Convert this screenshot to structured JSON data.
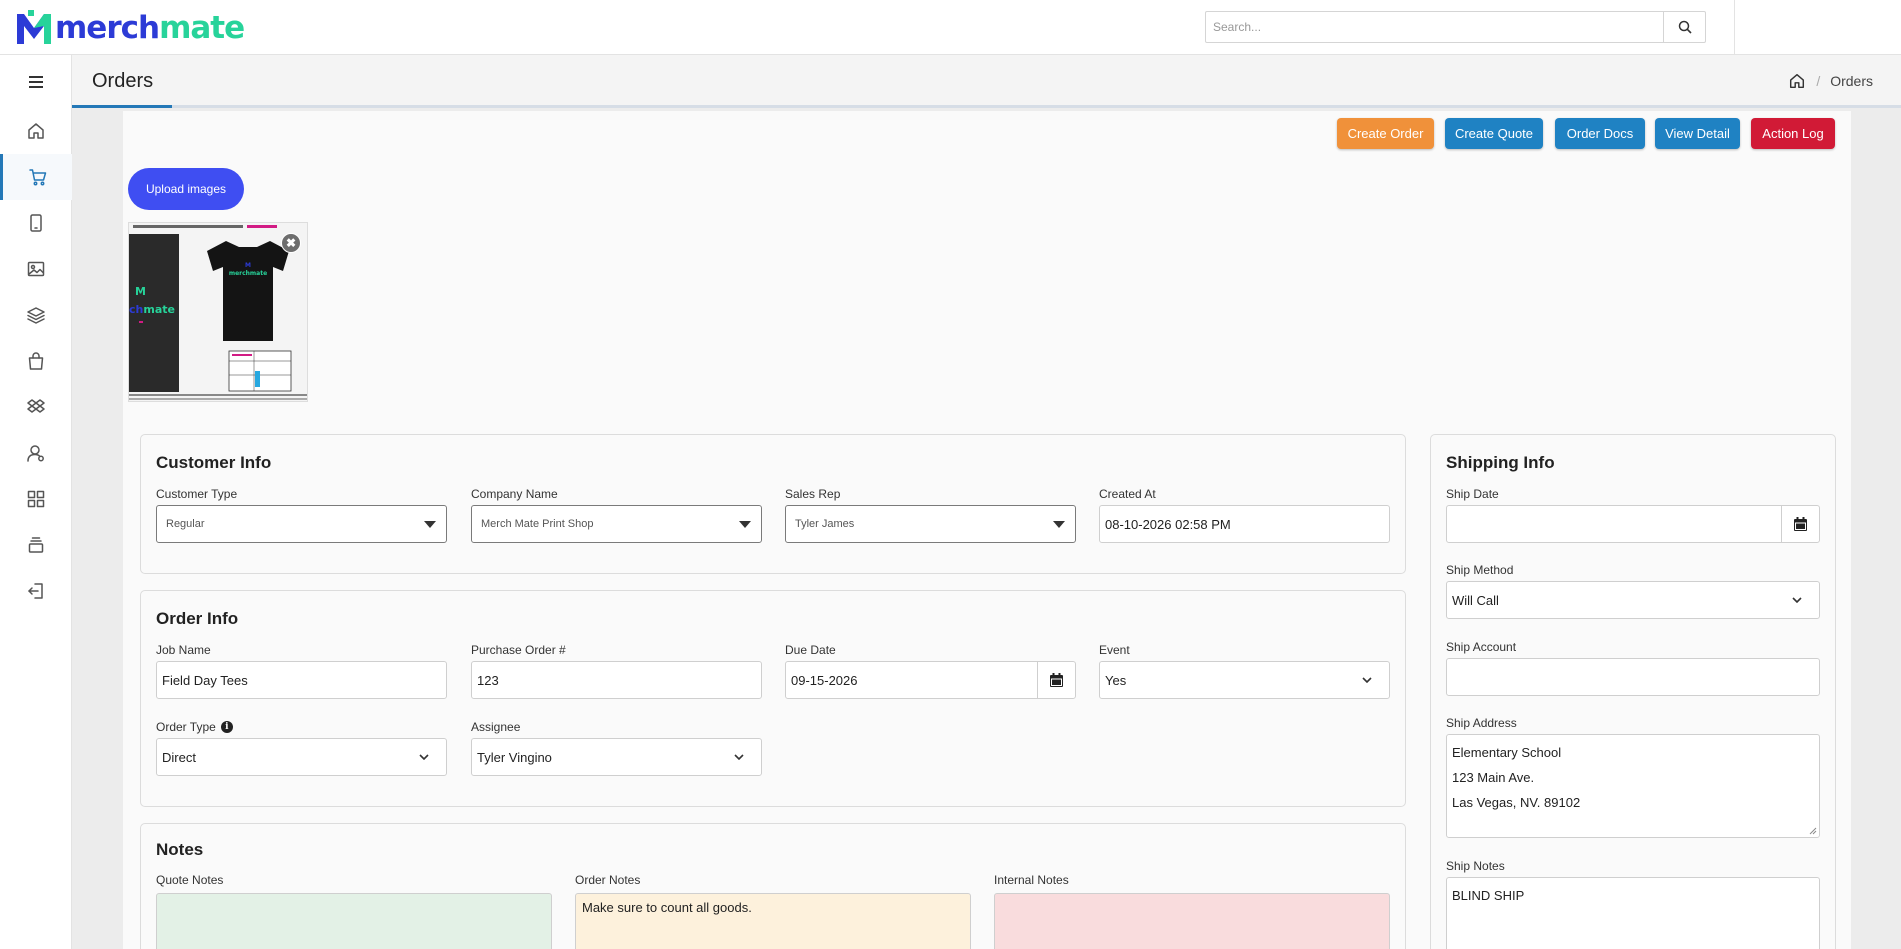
{
  "app": {
    "logo_part1": "merch",
    "logo_part2": "mate",
    "search_placeholder": "Search..."
  },
  "page": {
    "title": "Orders",
    "breadcrumb_current": "Orders"
  },
  "actions": [
    {
      "label": "Create Order",
      "color": "#f0913a"
    },
    {
      "label": "Create Quote",
      "color": "#1f82c3"
    },
    {
      "label": "Order Docs",
      "color": "#1f82c3"
    },
    {
      "label": "View Detail",
      "color": "#1f82c3"
    },
    {
      "label": "Action Log",
      "color": "#d11a36"
    }
  ],
  "upload": {
    "label": "Upload images",
    "thumb_logo_a": "ch",
    "thumb_logo_b": "mate",
    "thumb_shirt_text": "merchmate"
  },
  "customer_info": {
    "title": "Customer Info",
    "customer_type": {
      "label": "Customer Type",
      "value": "Regular"
    },
    "company_name": {
      "label": "Company Name",
      "value": "Merch Mate Print Shop"
    },
    "sales_rep": {
      "label": "Sales Rep",
      "value": "Tyler James"
    },
    "created_at": {
      "label": "Created At",
      "value": "08-10-2026 02:58 PM"
    }
  },
  "order_info": {
    "title": "Order Info",
    "job_name": {
      "label": "Job Name",
      "value": "Field Day Tees"
    },
    "po_number": {
      "label": "Purchase Order #",
      "value": "123"
    },
    "due_date": {
      "label": "Due Date",
      "value": "09-15-2026"
    },
    "event": {
      "label": "Event",
      "value": "Yes"
    },
    "order_type": {
      "label": "Order Type",
      "value": "Direct"
    },
    "assignee": {
      "label": "Assignee",
      "value": "Tyler Vingino"
    }
  },
  "notes": {
    "title": "Notes",
    "quote_notes": {
      "label": "Quote Notes",
      "value": "",
      "bg": "#e3f1e6"
    },
    "order_notes": {
      "label": "Order Notes",
      "value": "Make sure to count all goods.",
      "bg": "#fdf1dc"
    },
    "internal_notes": {
      "label": "Internal Notes",
      "value": "",
      "bg": "#f9dcdd"
    }
  },
  "shipping_info": {
    "title": "Shipping Info",
    "ship_date": {
      "label": "Ship Date",
      "value": ""
    },
    "ship_method": {
      "label": "Ship Method",
      "value": "Will Call"
    },
    "ship_account": {
      "label": "Ship Account",
      "value": ""
    },
    "ship_address": {
      "label": "Ship Address",
      "lines": [
        "Elementary School",
        "123 Main Ave.",
        "Las Vegas, NV. 89102"
      ]
    },
    "ship_notes": {
      "label": "Ship Notes",
      "value": "BLIND SHIP"
    }
  },
  "sidebar": {
    "active_index": 1,
    "icons": [
      "home-icon",
      "cart-icon",
      "tablet-icon",
      "image-icon",
      "layers-icon",
      "bag-icon",
      "dropbox-icon",
      "user-icon",
      "grid-icon",
      "stack-icon",
      "logout-icon"
    ]
  }
}
